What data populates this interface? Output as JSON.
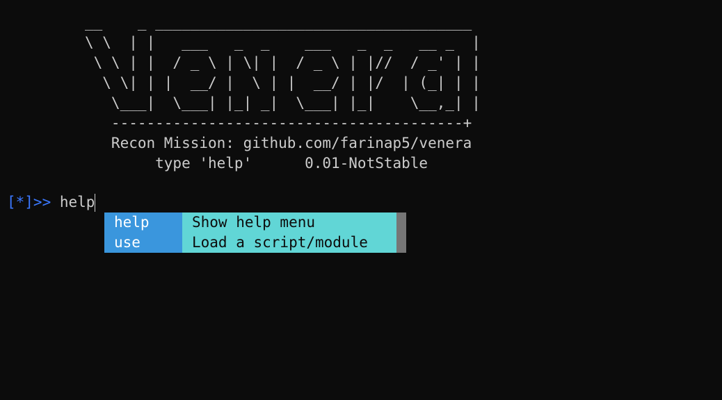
{
  "banner": {
    "ascii_art": "__    _ ____________________________________\n\\ \\  | |   ___   _  _    ___   _  _   __ _  |\n \\ \\ | |  / _ \\ | \\| |  / _ \\ | |//  / _' | |\n  \\ \\| | |  __/ |  \\ | |  __/ | |/  | (_| | |\n   \\___|  \\___| |_| _|  \\___| |_|    \\__,_| |\n   ----------------------------------------+\n   Recon Mission: github.com/farinap5/venera\n        type 'help'      0.01-NotStable"
  },
  "prompt": {
    "symbol": "[*]>> ",
    "input": "help"
  },
  "completion": {
    "items": [
      {
        "command": "help",
        "description": "Show help menu"
      },
      {
        "command": "use",
        "description": "Load a script/module"
      }
    ]
  },
  "colors": {
    "background": "#0c0c0c",
    "text": "#cccccc",
    "prompt": "#3b78ff",
    "command_highlight": "#3a96dd",
    "description_highlight": "#61d6d6",
    "scrollbar": "#767676"
  }
}
